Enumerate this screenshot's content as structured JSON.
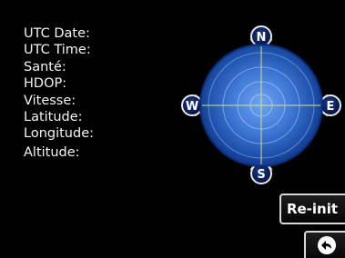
{
  "info_labels": {
    "utc_date": "UTC Date:",
    "utc_time": "UTC Time:",
    "sante": "Santé:",
    "hdop": "HDOP:",
    "vitesse": "Vitesse:",
    "latitude": "Latitude:",
    "longitude": "Longitude:",
    "altitude": "Altitude:"
  },
  "compass": {
    "north": "N",
    "east": "E",
    "south": "S",
    "west": "W",
    "colors": {
      "body_center": "#5a93e8",
      "body_edge": "#0c2f80",
      "marker_fill": "#0a1e5c",
      "ring": "#8fb8ff",
      "crosshair": "#d9e37a"
    }
  },
  "buttons": {
    "reinit_label": "Re-init",
    "back_icon": "back-arrow-icon"
  }
}
